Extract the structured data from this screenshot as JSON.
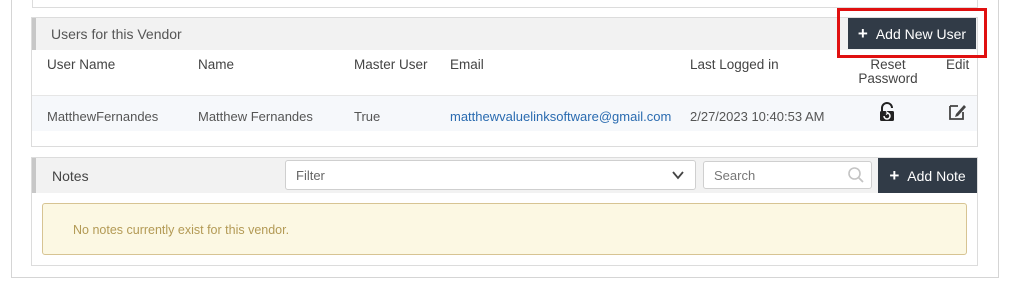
{
  "users_panel": {
    "title": "Users for this Vendor",
    "add_button_label": "Add New User",
    "columns": {
      "user_name": "User Name",
      "name": "Name",
      "master_user": "Master User",
      "email": "Email",
      "last_logged_in": "Last Logged in",
      "reset_password_line1": "Reset",
      "reset_password_line2": "Password",
      "edit": "Edit"
    },
    "rows": [
      {
        "user_name": "MatthewFernandes",
        "name": "Matthew Fernandes",
        "master_user": "True",
        "email": "matthewvaluelinksoftware@gmail.com",
        "last_logged_in": "2/27/2023 10:40:53 AM"
      }
    ]
  },
  "notes_panel": {
    "title": "Notes",
    "filter_placeholder": "Filter",
    "search_placeholder": "Search",
    "add_button_label": "Add Note",
    "empty_message": "No notes currently exist for this vendor."
  },
  "colors": {
    "button_bg": "#313b47",
    "highlight": "#e01010",
    "link": "#2a6bb0",
    "alert_bg": "#fcf8e3"
  }
}
